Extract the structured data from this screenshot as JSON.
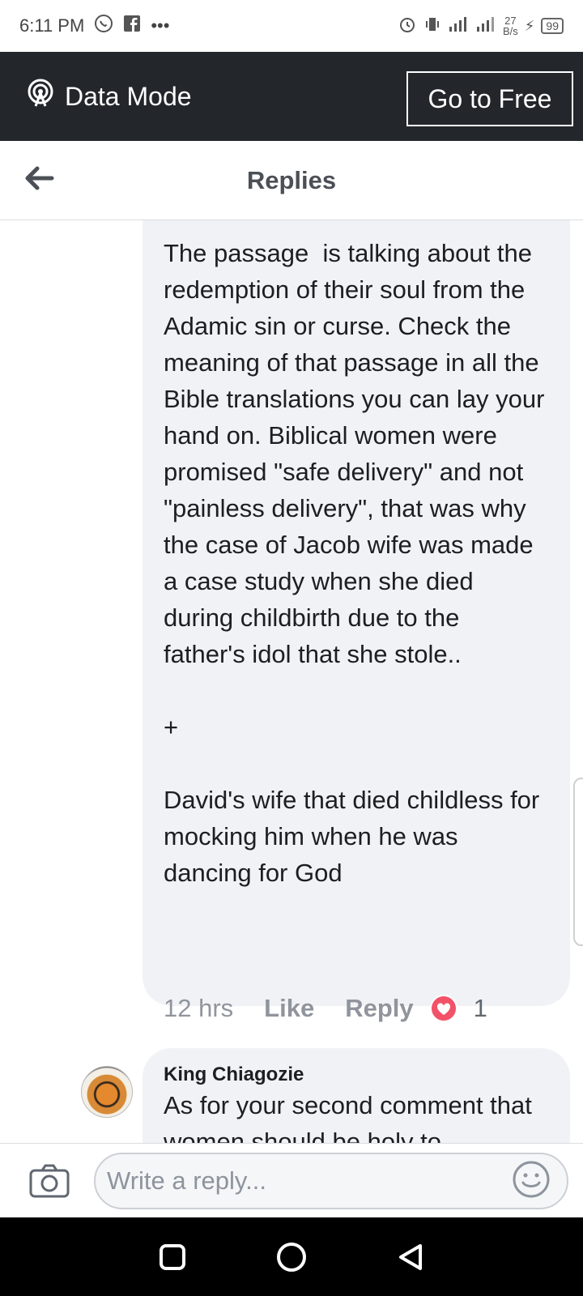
{
  "status_bar": {
    "time": "6:11 PM",
    "app_icons": [
      "whatsapp-icon",
      "facebook-icon"
    ],
    "more": "•••",
    "net_speed_value": "27",
    "net_speed_unit": "B/s",
    "battery": "99"
  },
  "data_mode": {
    "label": "Data Mode",
    "button_label": "Go to Free",
    "bg_color": "#23272b"
  },
  "header": {
    "title": "Replies"
  },
  "comment_main": {
    "text": "The passage  is talking about the redemption of their soul from the Adamic sin or curse. Check the meaning of that passage in all the Bible translations you can lay your hand on. Biblical women were promised \"safe delivery\" and not \"painless delivery\", that was why the case of Jacob wife was made a case study when she died during childbirth due to the father's idol that she stole..\n\n+\n\nDavid's wife that died childless for mocking him when he was dancing for God",
    "time": "12 hrs",
    "like_label": "Like",
    "reply_label": "Reply",
    "reaction_icon": "love-heart-icon",
    "reaction_count": "1"
  },
  "comment_second": {
    "author": "King Chiagozie",
    "text": "As for your second comment that women should be holy to"
  },
  "composer": {
    "placeholder": "Write a reply..."
  }
}
